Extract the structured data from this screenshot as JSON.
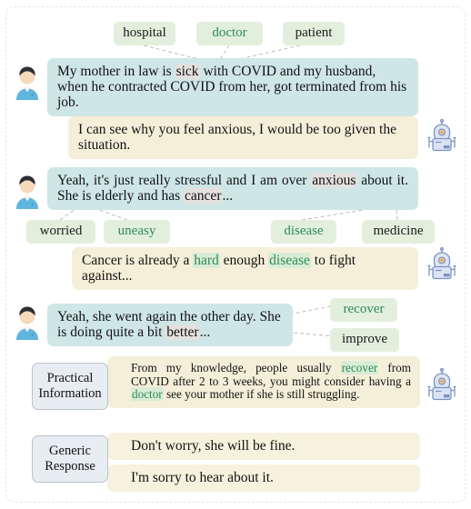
{
  "figure": {
    "frame_style": "dashed-rounded",
    "accent_green": "#2e8b57",
    "tag_bg": "#e3efdd",
    "user_bubble_bg": "#cfe6e6",
    "bot_bubble_bg": "#f5efd9",
    "label_bg": "#e8ecf3"
  },
  "tags_row_1": [
    {
      "label": "hospital",
      "green": false
    },
    {
      "label": "doctor",
      "green": true
    },
    {
      "label": "patient",
      "green": false
    }
  ],
  "tags_row_2": [
    {
      "label": "worried",
      "green": false
    },
    {
      "label": "uneasy",
      "green": true
    },
    {
      "label": "disease",
      "green": true
    },
    {
      "label": "medicine",
      "green": false
    }
  ],
  "tags_row_3": [
    {
      "label": "recover",
      "green": true
    },
    {
      "label": "improve",
      "green": false
    }
  ],
  "turns": {
    "user_1": {
      "speaker": "user",
      "text_parts": [
        {
          "t": "My mother in law is ",
          "hl": "none"
        },
        {
          "t": "sick",
          "hl": "grey"
        },
        {
          "t": " with COVID and my husband, when he contracted COVID from her, got terminated from his job.",
          "hl": "none"
        }
      ],
      "plain": "My mother in law is sick with COVID and my husband, when he contracted COVID from her, got terminated from his job."
    },
    "bot_1": {
      "speaker": "bot",
      "plain": "I can see why you feel anxious, I would be too given the situation."
    },
    "user_2": {
      "speaker": "user",
      "text_parts": [
        {
          "t": "Yeah, it's just really stressful and I am over ",
          "hl": "none"
        },
        {
          "t": "anxious",
          "hl": "grey"
        },
        {
          "t": " about it. She is elderly and has ",
          "hl": "none"
        },
        {
          "t": "cancer",
          "hl": "grey"
        },
        {
          "t": "...",
          "hl": "none"
        }
      ],
      "plain": "Yeah, it's just really stressful and I am over anxious about it. She is elderly and has cancer..."
    },
    "bot_2": {
      "speaker": "bot",
      "text_parts": [
        {
          "t": "Cancer is already a ",
          "hl": "none"
        },
        {
          "t": "hard",
          "hl": "green"
        },
        {
          "t": " enough ",
          "hl": "none"
        },
        {
          "t": "disease",
          "hl": "green"
        },
        {
          "t": " to fight against...",
          "hl": "none"
        }
      ],
      "plain": "Cancer is already a hard enough disease to fight against..."
    },
    "user_3": {
      "speaker": "user",
      "text_parts": [
        {
          "t": "Yeah, she went again the other day. She is doing quite a bit ",
          "hl": "none"
        },
        {
          "t": "better",
          "hl": "grey"
        },
        {
          "t": "...",
          "hl": "none"
        }
      ],
      "plain": "Yeah, she went again the other day. She is doing quite a bit better..."
    },
    "practical": {
      "label": "Practical\nInformation",
      "label_line_1": "Practical",
      "label_line_2": "Information",
      "text_parts": [
        {
          "t": "From my knowledge, people usually ",
          "hl": "none"
        },
        {
          "t": "recover",
          "hl": "green"
        },
        {
          "t": " from COVID after 2 to 3 weeks, you might consider having a ",
          "hl": "none"
        },
        {
          "t": "doctor",
          "hl": "green"
        },
        {
          "t": " see your mother if she is still struggling.",
          "hl": "none"
        }
      ],
      "plain": "From my knowledge, people usually recover from COVID after 2 to 3 weeks, you might consider having a doctor see your mother if she is still struggling."
    },
    "generic": {
      "label_line_1": "Generic",
      "label_line_2": "Response",
      "responses": [
        "Don't worry, she will be fine.",
        "I'm sorry to hear about it."
      ]
    }
  },
  "icons": {
    "user_avatar": "user-avatar-icon",
    "bot_avatar": "robot-avatar-icon"
  }
}
